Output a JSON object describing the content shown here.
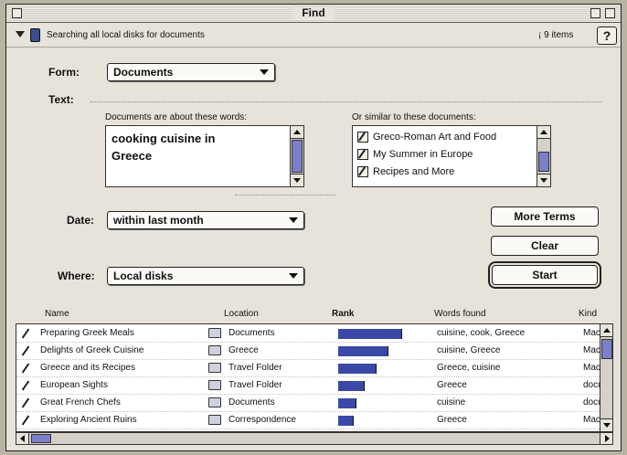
{
  "window": {
    "title": "Find"
  },
  "status": {
    "searching_text": "Searching all local disks for documents",
    "item_count": "9 items",
    "help_label": "?"
  },
  "form": {
    "label": "Form:",
    "value": "Documents"
  },
  "text": {
    "label": "Text:",
    "words_label": "Documents are about these words:",
    "words_value": "cooking cuisine in\nGreece",
    "similar_label": "Or similar to these documents:",
    "similar_docs": [
      "Greco-Roman Art and Food",
      "My Summer in Europe",
      "Recipes and More"
    ]
  },
  "date": {
    "label": "Date:",
    "value": "within last month"
  },
  "where": {
    "label": "Where:",
    "value": "Local disks"
  },
  "buttons": {
    "more_terms": "More Terms",
    "clear": "Clear",
    "start": "Start"
  },
  "results": {
    "columns": [
      "Name",
      "Location",
      "Rank",
      "Words found",
      "Kind"
    ],
    "rows": [
      {
        "name": "Preparing Greek Meals",
        "location": "Documents",
        "rank": 1.0,
        "words": "cuisine, cook, Greece",
        "kind": "MacW"
      },
      {
        "name": "Delights of Greek Cuisine",
        "location": "Greece",
        "rank": 0.78,
        "words": "cuisine, Greece",
        "kind": "MacW"
      },
      {
        "name": "Greece and its Recipes",
        "location": "Travel Folder",
        "rank": 0.6,
        "words": "Greece, cuisine",
        "kind": "MacW"
      },
      {
        "name": "European Sights",
        "location": "Travel Folder",
        "rank": 0.42,
        "words": "Greece",
        "kind": "docum"
      },
      {
        "name": "Great French Chefs",
        "location": "Documents",
        "rank": 0.28,
        "words": "cuisine",
        "kind": "docum"
      },
      {
        "name": "Exploring Ancient Ruins",
        "location": "Correspondence",
        "rank": 0.24,
        "words": "Greece",
        "kind": "MacW"
      }
    ]
  }
}
